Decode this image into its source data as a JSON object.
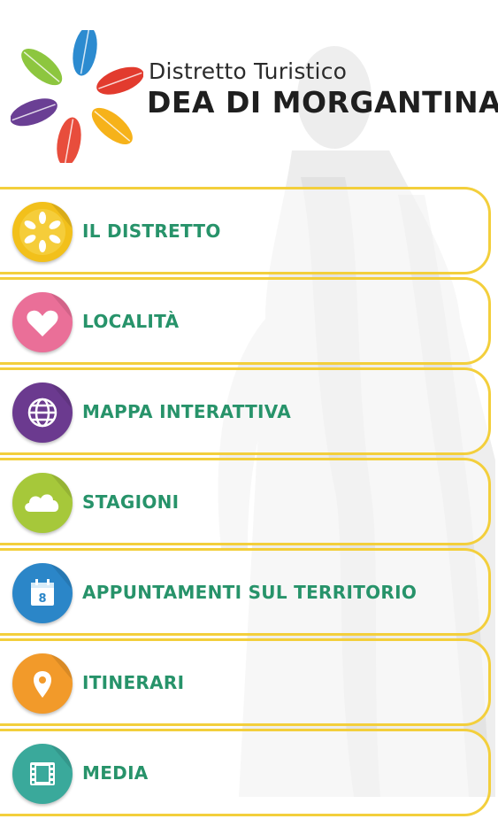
{
  "brand": {
    "line1": "Distretto Turistico",
    "line2": "DEA DI MORGANTINA"
  },
  "menu": {
    "items": [
      {
        "label": "IL DISTRETTO",
        "icon": "district-emblem-icon",
        "color": "#f2c01b"
      },
      {
        "label": "LOCALITÀ",
        "icon": "heart-icon",
        "color": "#ea6f98"
      },
      {
        "label": "MAPPA INTERATTIVA",
        "icon": "globe-icon",
        "color": "#6b3a8f"
      },
      {
        "label": "STAGIONI",
        "icon": "cloud-icon",
        "color": "#a6c83a"
      },
      {
        "label": "APPUNTAMENTI SUL TERRITORIO",
        "icon": "calendar-icon",
        "color": "#2b86c8"
      },
      {
        "label": "ITINERARI",
        "icon": "location-pin-icon",
        "color": "#f29a2a"
      },
      {
        "label": "MEDIA",
        "icon": "film-icon",
        "color": "#3aa99b"
      }
    ]
  },
  "colors": {
    "accent_border": "#f3cf3c",
    "label_text": "#27936a"
  }
}
